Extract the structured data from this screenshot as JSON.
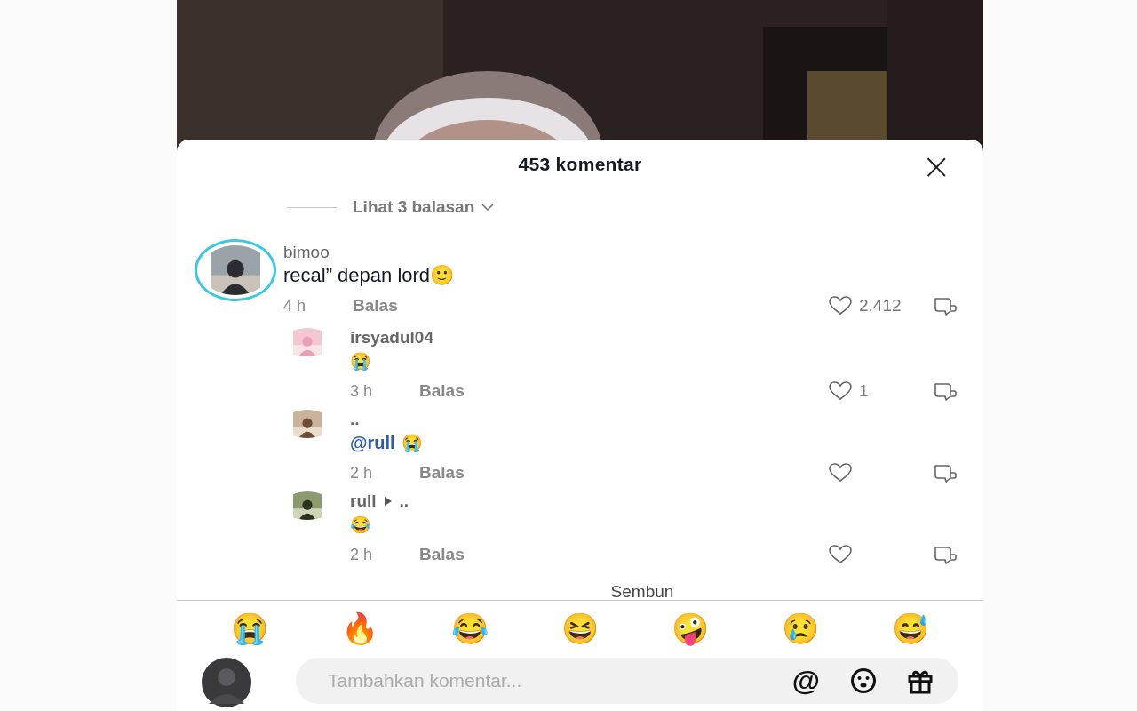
{
  "header": {
    "title": "453 komentar",
    "close": "×"
  },
  "more_replies": {
    "label": "Lihat 3 balasan",
    "expanded": false
  },
  "comments": [
    {
      "kind": "top",
      "user": "bimoo",
      "story_ring": true,
      "text": "recal” depan lord🙂",
      "time": "4 h",
      "reply": "Balas",
      "likes": "2.412",
      "liked": false
    },
    {
      "kind": "reply",
      "user": "irsyadul04",
      "story_ring": false,
      "text": "😭",
      "time": "3 h",
      "reply": "Balas",
      "likes": "1",
      "liked": false
    },
    {
      "kind": "reply",
      "user": "..",
      "story_ring": false,
      "mention": "@rull",
      "text": "😭",
      "time": "2 h",
      "reply": "Balas",
      "liked": false
    },
    {
      "kind": "reply",
      "user": "rull",
      "reply_to": "..",
      "story_ring": false,
      "text": "😂",
      "time": "2 h",
      "reply": "Balas",
      "liked": false
    }
  ],
  "hide_label": "Sembun",
  "quick_emojis": [
    "😭",
    "🔥",
    "😂",
    "😆",
    "🤪",
    "😢",
    "😅"
  ],
  "composer": {
    "placeholder": "Tambahkan komentar...",
    "mention": "@"
  }
}
